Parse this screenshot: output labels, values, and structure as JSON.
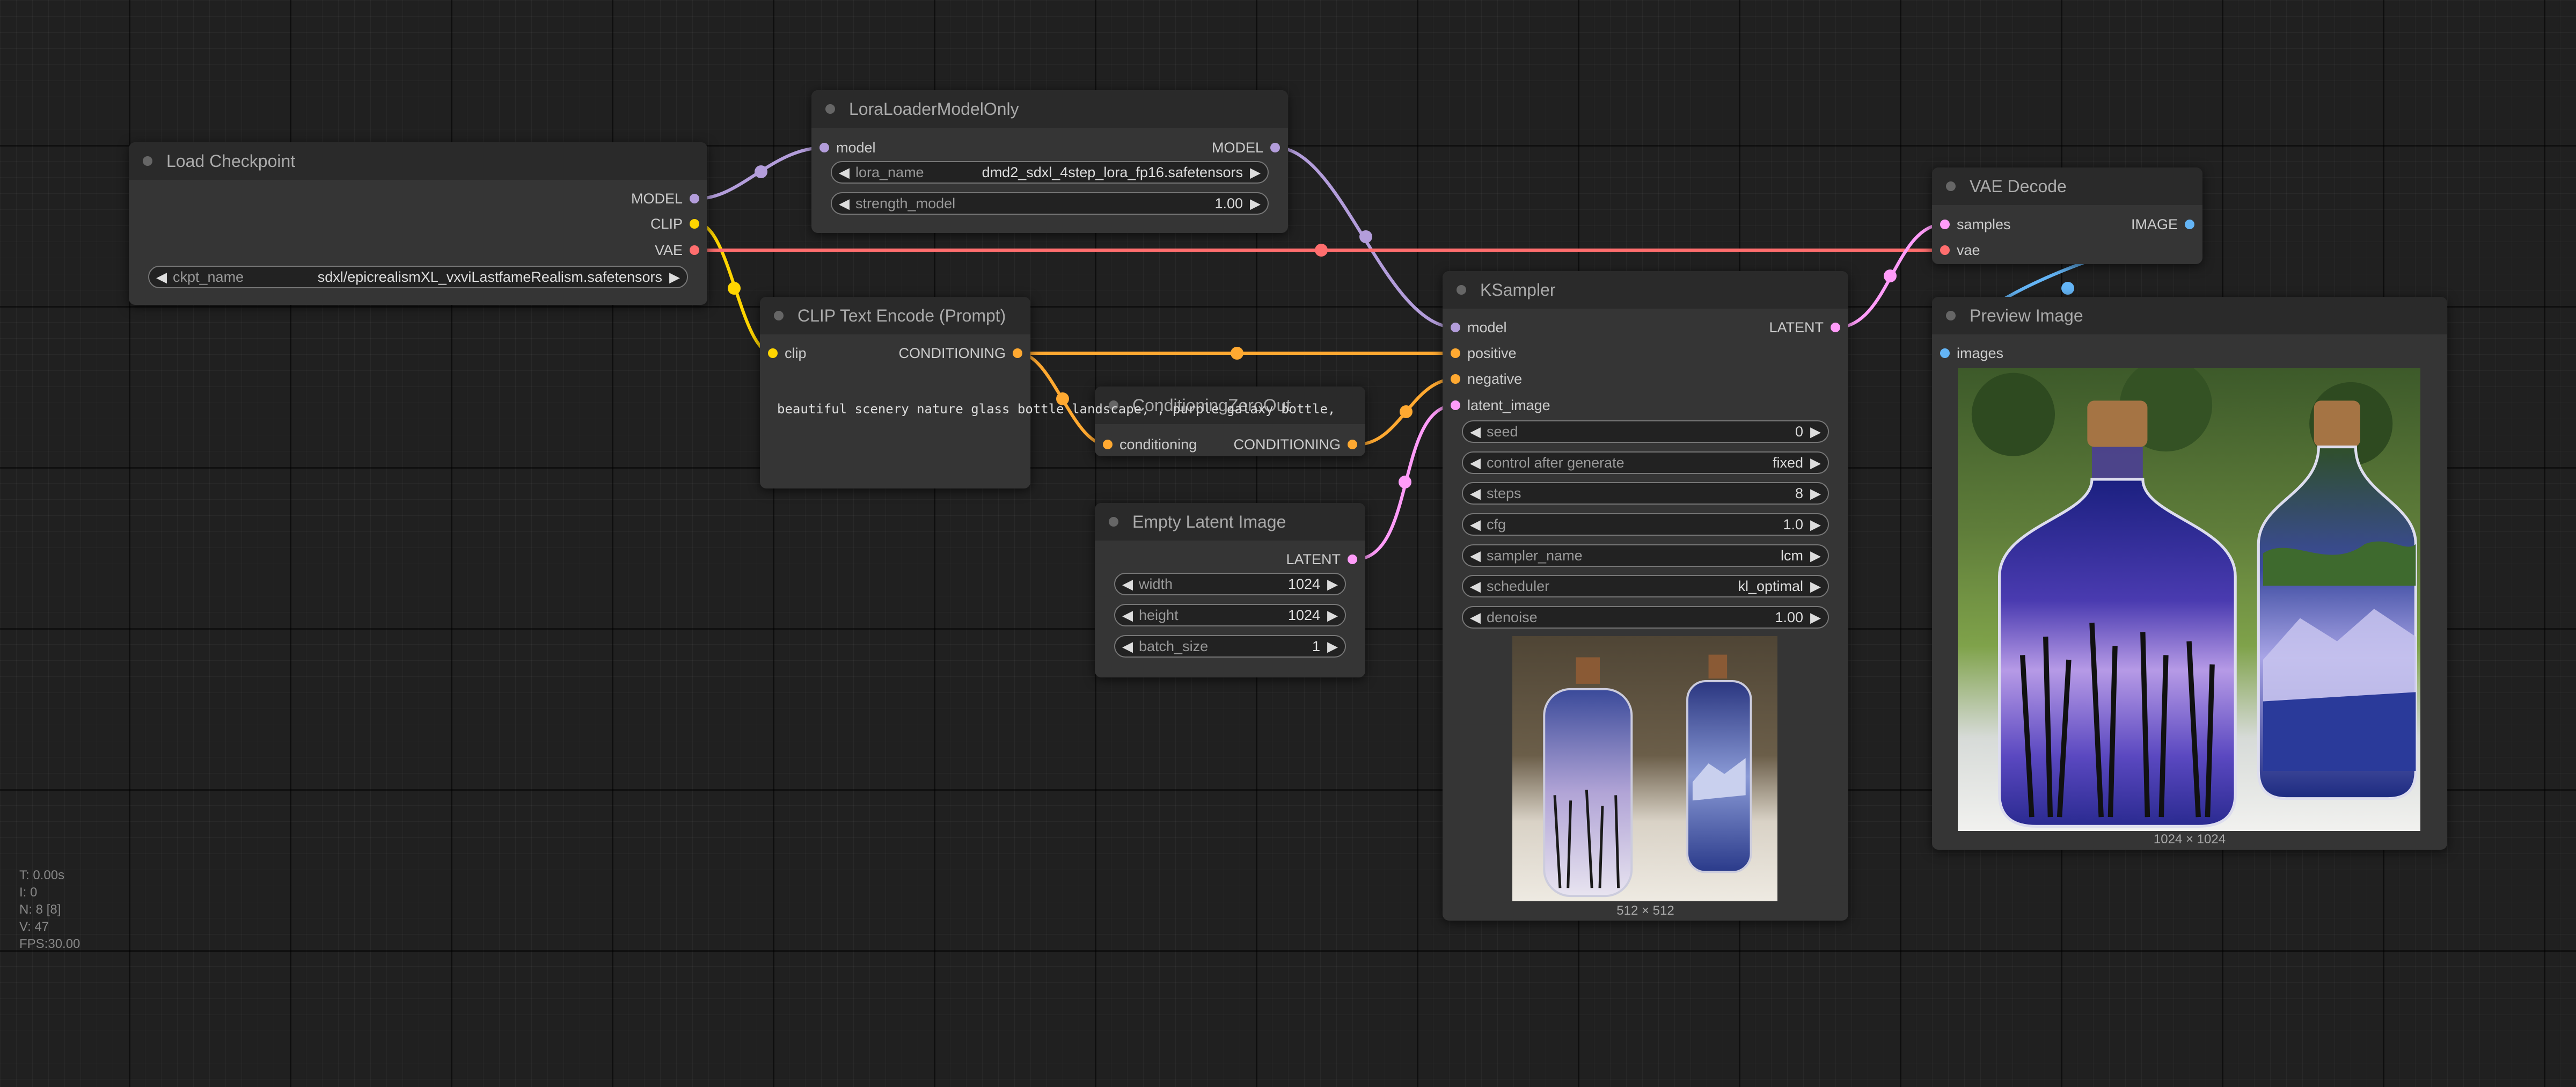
{
  "colors": {
    "model": "#b39ddb",
    "clip": "#ffd500",
    "vae": "#ff6e6e",
    "conditioning": "#ffa931",
    "latent": "#ff9cf9",
    "image": "#64b5f6"
  },
  "nodes": {
    "load_checkpoint": {
      "title": "Load Checkpoint",
      "outputs": [
        "MODEL",
        "CLIP",
        "VAE"
      ],
      "widget": {
        "label": "ckpt_name",
        "value": "sdxl/epicrealismXL_vxviLastfameRealism.safetensors"
      }
    },
    "lora": {
      "title": "LoraLoaderModelOnly",
      "input": "model",
      "output": "MODEL",
      "widgets": [
        {
          "label": "lora_name",
          "value": "dmd2_sdxl_4step_lora_fp16.safetensors"
        },
        {
          "label": "strength_model",
          "value": "1.00"
        }
      ]
    },
    "clip_text": {
      "title": "CLIP Text Encode (Prompt)",
      "input": "clip",
      "output": "CONDITIONING",
      "text": "beautiful scenery nature glass bottle landscape, , purple galaxy bottle,"
    },
    "zero_out": {
      "title": "ConditioningZeroOut",
      "input": "conditioning",
      "output": "CONDITIONING"
    },
    "empty_latent": {
      "title": "Empty Latent Image",
      "output": "LATENT",
      "widgets": [
        {
          "label": "width",
          "value": "1024"
        },
        {
          "label": "height",
          "value": "1024"
        },
        {
          "label": "batch_size",
          "value": "1"
        }
      ]
    },
    "ksampler": {
      "title": "KSampler",
      "inputs": [
        "model",
        "positive",
        "negative",
        "latent_image"
      ],
      "output": "LATENT",
      "widgets": [
        {
          "label": "seed",
          "value": "0"
        },
        {
          "label": "control after generate",
          "value": "fixed"
        },
        {
          "label": "steps",
          "value": "8"
        },
        {
          "label": "cfg",
          "value": "1.0"
        },
        {
          "label": "sampler_name",
          "value": "lcm"
        },
        {
          "label": "scheduler",
          "value": "kl_optimal"
        },
        {
          "label": "denoise",
          "value": "1.00"
        }
      ],
      "preview_size": "512 × 512"
    },
    "vae_decode": {
      "title": "VAE Decode",
      "inputs": [
        "samples",
        "vae"
      ],
      "output": "IMAGE"
    },
    "preview": {
      "title": "Preview Image",
      "input": "images",
      "image_size": "1024 × 1024"
    }
  },
  "stats": {
    "t": "T: 0.00s",
    "i": "I: 0",
    "n": "N: 8 [8]",
    "v": "V: 47",
    "fps": "FPS:30.00"
  }
}
